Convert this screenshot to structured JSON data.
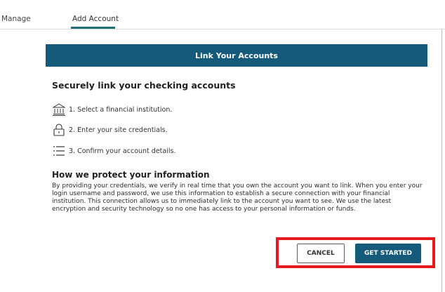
{
  "tabs": {
    "manage": "Manage",
    "add_account": "Add Account"
  },
  "header": {
    "title": "Link Your Accounts"
  },
  "section": {
    "title": "Securely link your checking accounts"
  },
  "steps": [
    {
      "icon": "bank-icon",
      "label": "1. Select a financial institution."
    },
    {
      "icon": "lock-icon",
      "label": "2. Enter your site credentials."
    },
    {
      "icon": "list-icon",
      "label": "3. Confirm your account details."
    }
  ],
  "protect": {
    "title": "How we protect your information",
    "body": "By providing your credentials, we verify in real time that you own the account you want to link. When you enter your login username and password, we use this information to establish a secure connection with your financial institution. This connection allows us to immediately link to the account you want to see. We use the latest encryption and security technology so no one has access to your personal information or funds."
  },
  "buttons": {
    "cancel": "CANCEL",
    "get_started": "GET STARTED"
  },
  "colors": {
    "primary": "#155a7a",
    "accent_tab": "#1e6e73",
    "highlight": "#e8161f"
  }
}
